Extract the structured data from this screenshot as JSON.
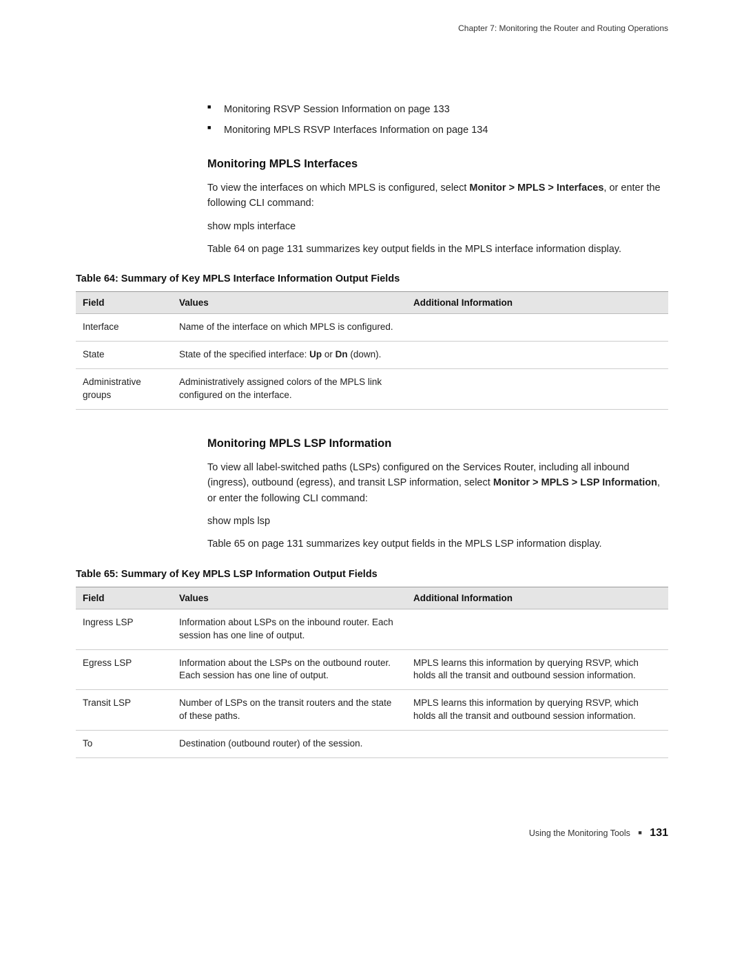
{
  "header": {
    "chapter": "Chapter 7: Monitoring the Router and Routing Operations"
  },
  "bullets": [
    "Monitoring RSVP Session Information on page 133",
    "Monitoring MPLS RSVP Interfaces Information on page 134"
  ],
  "section1": {
    "title": "Monitoring MPLS Interfaces",
    "p1a": "To view the interfaces on which MPLS is configured, select ",
    "p1b": "Monitor > MPLS > Interfaces",
    "p1c": ", or enter the following CLI command:",
    "cmd": "show mpls interface",
    "p2": "Table 64 on page 131 summarizes key output fields in the MPLS interface information display."
  },
  "table64": {
    "caption": "Table 64: Summary of Key MPLS Interface Information Output Fields",
    "headers": [
      "Field",
      "Values",
      "Additional Information"
    ],
    "rows": [
      {
        "field": "Interface",
        "values": "Name of the interface on which MPLS is configured.",
        "info": ""
      },
      {
        "field": "State",
        "values_pre": "State of the specified interface: ",
        "b1": "Up",
        "mid": " or ",
        "b2": "Dn",
        "values_post": " (down).",
        "info": ""
      },
      {
        "field": "Administrative groups",
        "values": "Administratively assigned colors of the MPLS link configured on the interface.",
        "info": ""
      }
    ]
  },
  "section2": {
    "title": "Monitoring MPLS LSP Information",
    "p1a": "To view all label-switched paths (LSPs) configured on the Services Router, including all inbound (ingress), outbound (egress), and transit LSP information, select ",
    "p1b": "Monitor > MPLS > LSP Information",
    "p1c": ", or enter the following CLI command:",
    "cmd": "show mpls lsp",
    "p2": "Table 65 on page 131 summarizes key output fields in the MPLS LSP information display."
  },
  "table65": {
    "caption": "Table 65: Summary of Key MPLS LSP Information Output Fields",
    "headers": [
      "Field",
      "Values",
      "Additional Information"
    ],
    "rows": [
      {
        "field": "Ingress LSP",
        "values": "Information about LSPs on the inbound router. Each session has one line of output.",
        "info": ""
      },
      {
        "field": "Egress LSP",
        "values": "Information about the LSPs on the outbound router. Each session has one line of output.",
        "info": "MPLS learns this information by querying RSVP, which holds all the transit and outbound session information."
      },
      {
        "field": "Transit LSP",
        "values": "Number of LSPs on the transit routers and the state of these paths.",
        "info": "MPLS learns this information by querying RSVP, which holds all the transit and outbound session information."
      },
      {
        "field": "To",
        "values": "Destination (outbound router) of the session.",
        "info": ""
      }
    ]
  },
  "footer": {
    "text": "Using the Monitoring Tools",
    "page": "131"
  }
}
